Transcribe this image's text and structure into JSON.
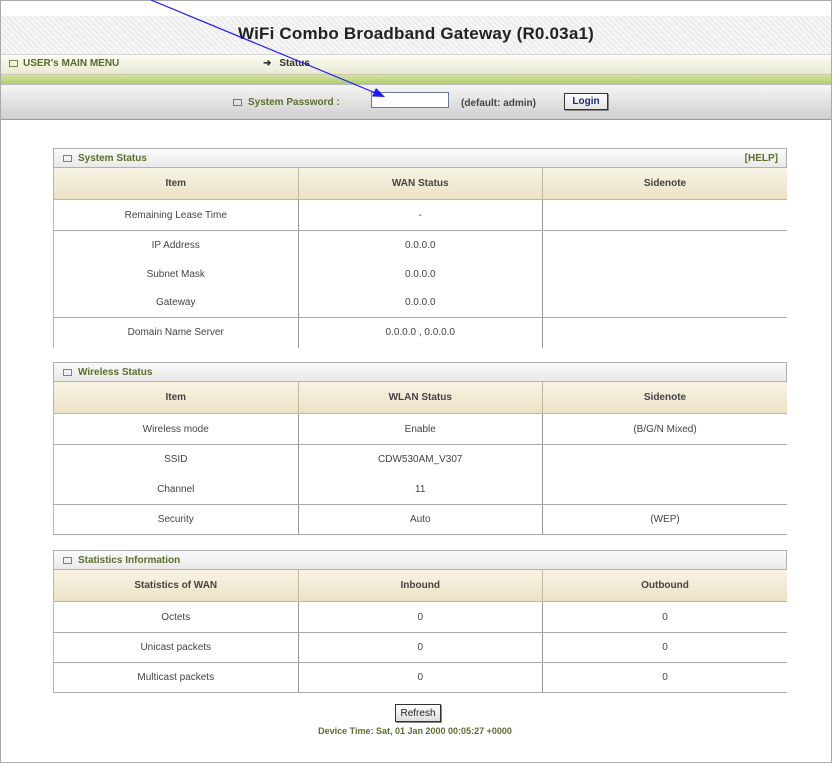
{
  "header": {
    "title": "WiFi Combo Broadband Gateway (R0.03a1)"
  },
  "menu": {
    "user_main_menu": "USER's MAIN MENU",
    "current_page": "Status"
  },
  "login": {
    "password_label": "System Password :",
    "password_value": "",
    "default_hint": "(default: admin)",
    "login_button": "Login"
  },
  "system_status": {
    "title": "System Status",
    "help": "[HELP]",
    "columns": [
      "Item",
      "WAN Status",
      "Sidenote"
    ],
    "rows": [
      [
        "Remaining Lease Time",
        "-",
        ""
      ],
      [
        "IP Address",
        "0.0.0.0",
        ""
      ],
      [
        "Subnet Mask",
        "0.0.0.0",
        ""
      ],
      [
        "Gateway",
        "0.0.0.0",
        ""
      ],
      [
        "Domain Name Server",
        "0.0.0.0 , 0.0.0.0",
        ""
      ]
    ]
  },
  "wireless_status": {
    "title": "Wireless Status",
    "columns": [
      "Item",
      "WLAN Status",
      "Sidenote"
    ],
    "rows": [
      [
        "Wireless mode",
        "Enable",
        "(B/G/N Mixed)"
      ],
      [
        "SSID",
        "CDW530AM_V307",
        ""
      ],
      [
        "Channel",
        "11",
        ""
      ],
      [
        "Security",
        "Auto",
        "(WEP)"
      ]
    ]
  },
  "statistics": {
    "title": "Statistics Information",
    "columns": [
      "Statistics of WAN",
      "Inbound",
      "Outbound"
    ],
    "rows": [
      [
        "Octets",
        "0",
        "0"
      ],
      [
        "Unicast packets",
        "0",
        "0"
      ],
      [
        "Multicast packets",
        "0",
        "0"
      ]
    ]
  },
  "footer": {
    "refresh_button": "Refresh",
    "device_time": "Device Time: Sat, 01 Jan 2000 00:05:27 +0000"
  },
  "colors": {
    "accent_green": "#5a6e2c",
    "annotation_arrow": "#1a1aff"
  }
}
